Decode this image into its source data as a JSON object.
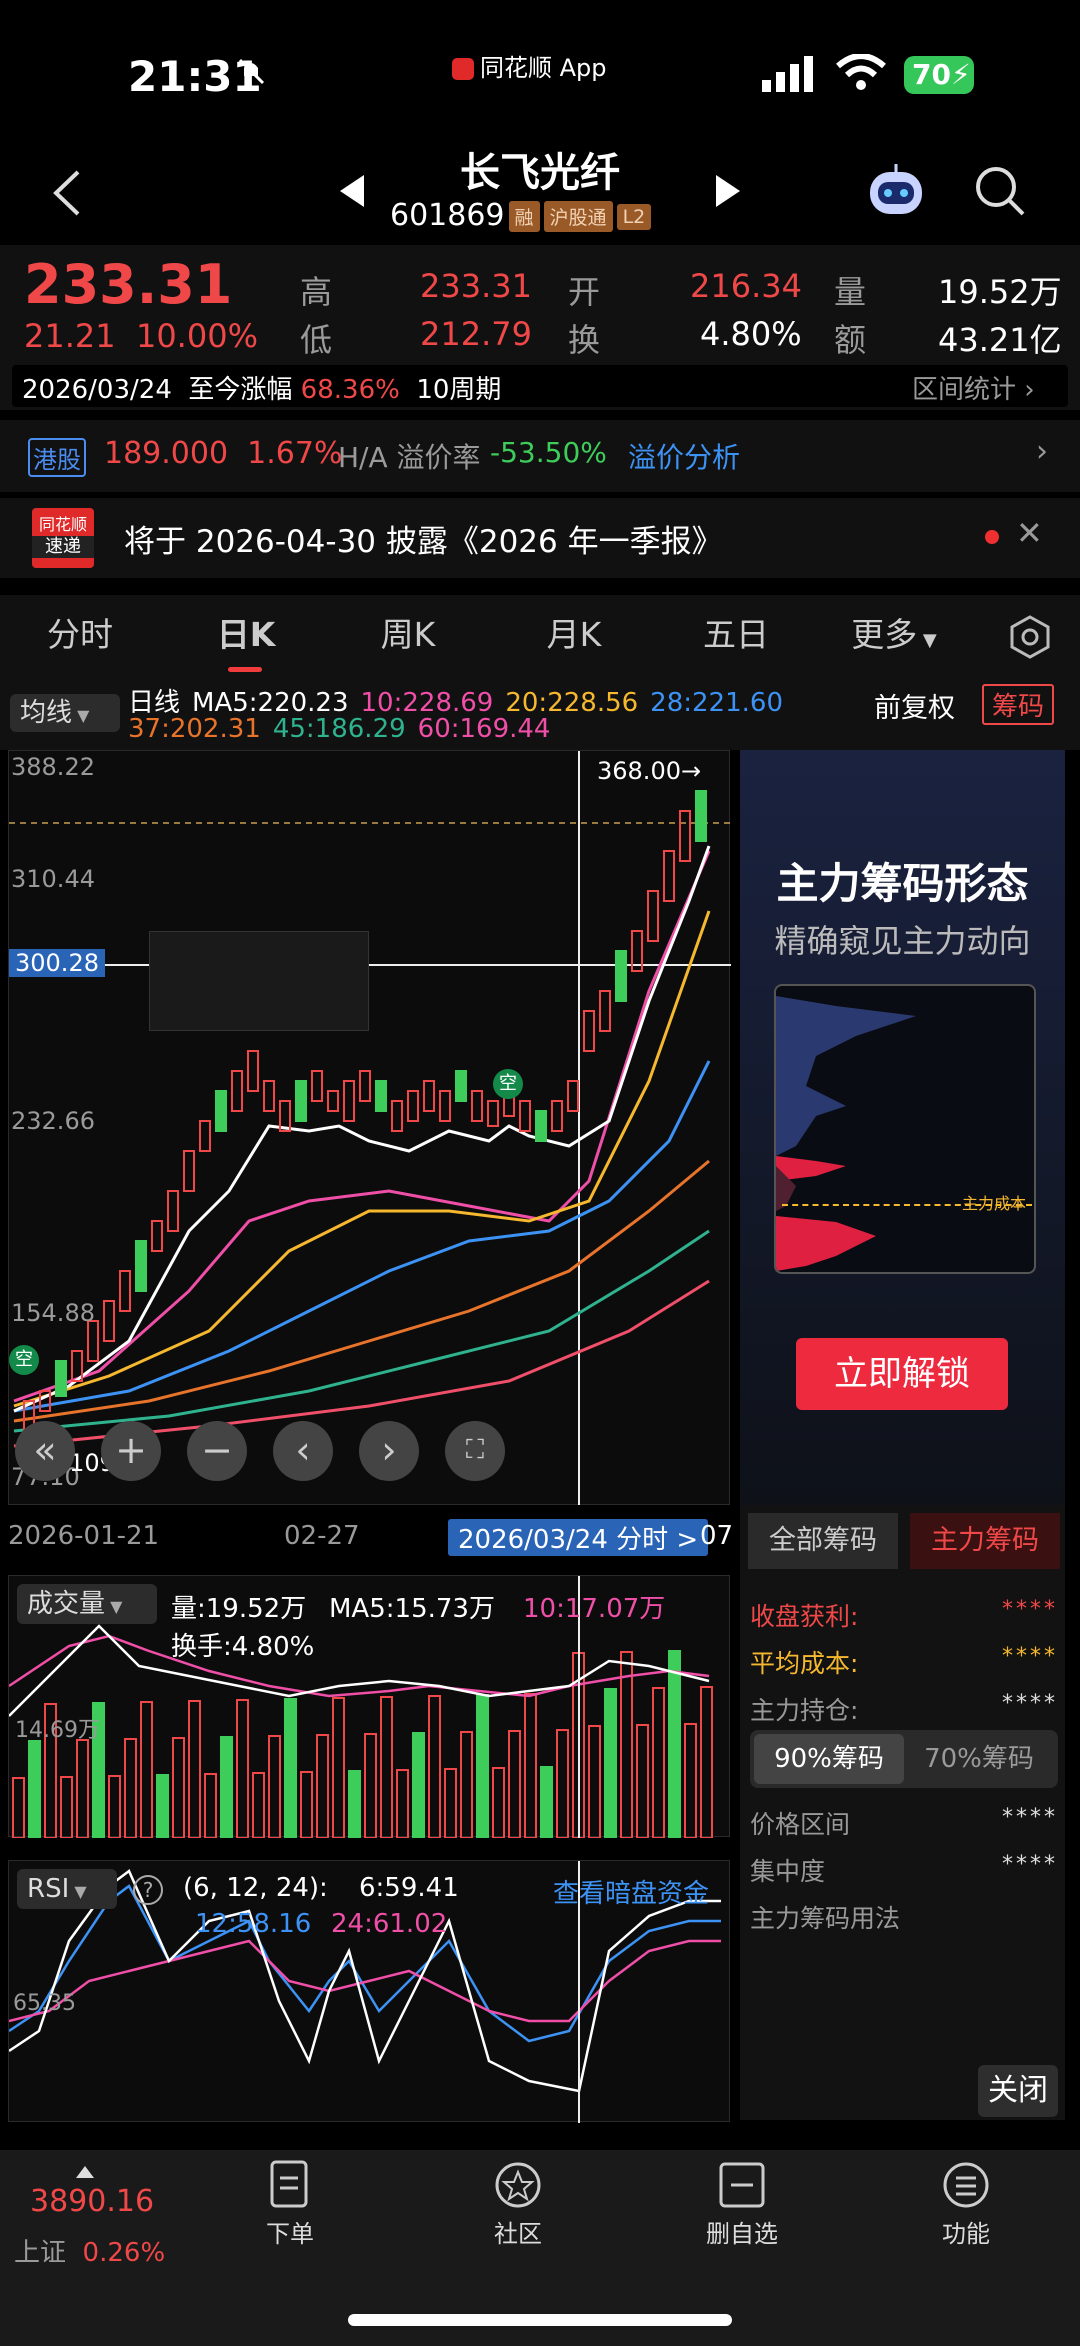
{
  "status_bar": {
    "time": "21:31",
    "app_label": "同花顺 App",
    "battery": "70"
  },
  "header": {
    "title": "长飞光纤",
    "code": "601869",
    "tags": [
      "融",
      "沪股通",
      "L2"
    ]
  },
  "quote": {
    "price": "233.31",
    "change": "21.21",
    "change_pct": "10.00%",
    "high_label": "高",
    "high": "233.31",
    "low_label": "低",
    "low": "212.79",
    "open_label": "开",
    "open": "216.34",
    "turnover_label": "换",
    "turnover": "4.80%",
    "vol_label": "量",
    "vol": "19.52万",
    "amt_label": "额",
    "amt": "43.21亿"
  },
  "period_bar": {
    "date": "2026/03/24",
    "label": "至今涨幅",
    "pct": "68.36%",
    "periods": "10周期",
    "stat": "区间统计"
  },
  "hk": {
    "tag": "港股",
    "price": "189.000",
    "pct": "1.67%",
    "ha_label": "H/A 溢价率",
    "ha_value": "-53.50%",
    "link": "溢价分析"
  },
  "notice": {
    "logo_top": "同花顺",
    "logo_bottom": "速递",
    "text": "将于 2026-04-30 披露《2026 年一季报》"
  },
  "tabs": [
    "分时",
    "日K",
    "周K",
    "月K",
    "五日",
    "更多"
  ],
  "ma_bar": {
    "selector": "均线",
    "r1": [
      {
        "t": "日线",
        "c": "#ffffff"
      },
      {
        "t": "MA5:220.23",
        "c": "#ffffff"
      },
      {
        "t": "10:228.69",
        "c": "#f04fa8"
      },
      {
        "t": "20:228.56",
        "c": "#f5b82e"
      },
      {
        "t": "28:221.60",
        "c": "#3d93f5"
      }
    ],
    "r2": [
      {
        "t": "37:202.31",
        "c": "#e8742c"
      },
      {
        "t": "45:186.29",
        "c": "#2fb38f"
      },
      {
        "t": "60:169.44",
        "c": "#f04fa8"
      }
    ],
    "fq": "前复权",
    "chip": "筹码"
  },
  "kchart": {
    "y_labels": [
      "388.22",
      "310.44",
      "232.66",
      "154.88",
      "77.10"
    ],
    "cross_price": "300.28",
    "max_label": "368.00",
    "min_label": "109.18",
    "x_labels": [
      "2026-01-21",
      "02-27"
    ],
    "cross_date": "2026/03/24 分时 >",
    "x_last": "07"
  },
  "promo": {
    "title": "主力筹码形态",
    "sub": "精确窥见主力动向",
    "cost": "主力成本",
    "unlock": "立即解锁"
  },
  "chips": {
    "tab1": "全部筹码",
    "tab2": "主力筹码",
    "rows": [
      {
        "k": "收盘获利:",
        "v": "****",
        "kc": "#f04848",
        "vc": "#f04848"
      },
      {
        "k": "平均成本:",
        "v": "****",
        "kc": "#f5b82e",
        "vc": "#f5b82e"
      },
      {
        "k": "主力持仓:",
        "v": "****",
        "kc": "#999",
        "vc": "#ddd"
      }
    ],
    "seg1": "90%筹码",
    "seg2": "70%筹码",
    "rows2": [
      {
        "k": "价格区间",
        "v": "****"
      },
      {
        "k": "集中度",
        "v": "****"
      },
      {
        "k": "主力筹码用法",
        "v": ""
      }
    ],
    "close": "关闭"
  },
  "volume": {
    "selector": "成交量",
    "vol": "量:19.52万",
    "ma5": "MA5:15.73万",
    "ma10": "10:17.07万",
    "turn": "换手:4.80%",
    "axis": "14.69万"
  },
  "rsi": {
    "selector": "RSI",
    "params": "(6, 12, 24):",
    "v6": "6:59.41",
    "v12": "12:58.16",
    "v24": "24:61.02",
    "link": "查看暗盘资金",
    "axis": "65.35"
  },
  "bottom": {
    "index_value": "3890.16",
    "index_name": "上证",
    "index_pct": "0.26%",
    "items": [
      "下单",
      "社区",
      "删自选",
      "功能"
    ]
  }
}
